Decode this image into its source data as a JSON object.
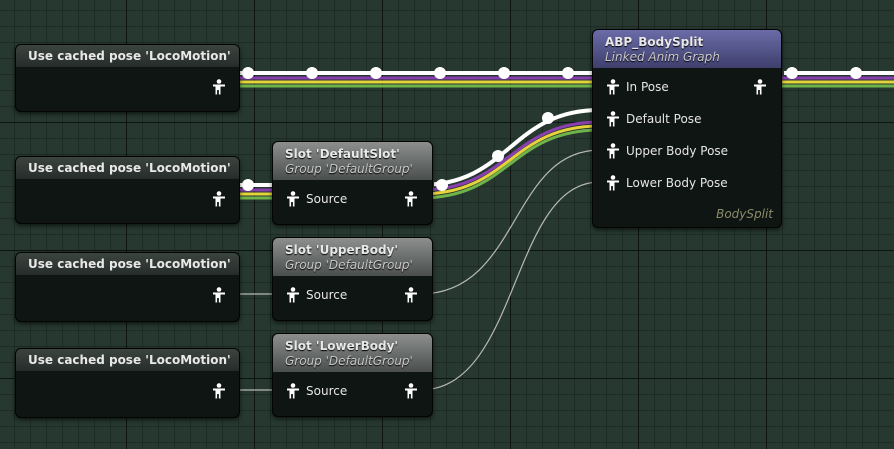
{
  "cached_nodes": [
    {
      "title": "Use cached pose 'LocoMotion'"
    },
    {
      "title": "Use cached pose 'LocoMotion'"
    },
    {
      "title": "Use cached pose 'LocoMotion'"
    },
    {
      "title": "Use cached pose 'LocoMotion'"
    }
  ],
  "slot_nodes": [
    {
      "title": "Slot 'DefaultSlot'",
      "group": "Group 'DefaultGroup'",
      "input_label": "Source"
    },
    {
      "title": "Slot 'UpperBody'",
      "group": "Group 'DefaultGroup'",
      "input_label": "Source"
    },
    {
      "title": "Slot 'LowerBody'",
      "group": "Group 'DefaultGroup'",
      "input_label": "Source"
    }
  ],
  "linked_node": {
    "title": "ABP_BodySplit",
    "subtitle": "Linked Anim Graph",
    "inputs": [
      "In Pose",
      "Default Pose",
      "Upper Body Pose",
      "Lower Body Pose"
    ],
    "footer": "BodySplit"
  },
  "colors": {
    "wire_white": "#ffffff",
    "wire_purple": "#8a3fb0",
    "wire_yellow": "#e6d23a",
    "wire_green": "#6fb34a",
    "thin_wire": "#b8b8b8",
    "linked_header": "#5d5e9c",
    "slot_header": "#7f8281"
  },
  "icons": {
    "pose_pin": "pose-person-icon"
  }
}
